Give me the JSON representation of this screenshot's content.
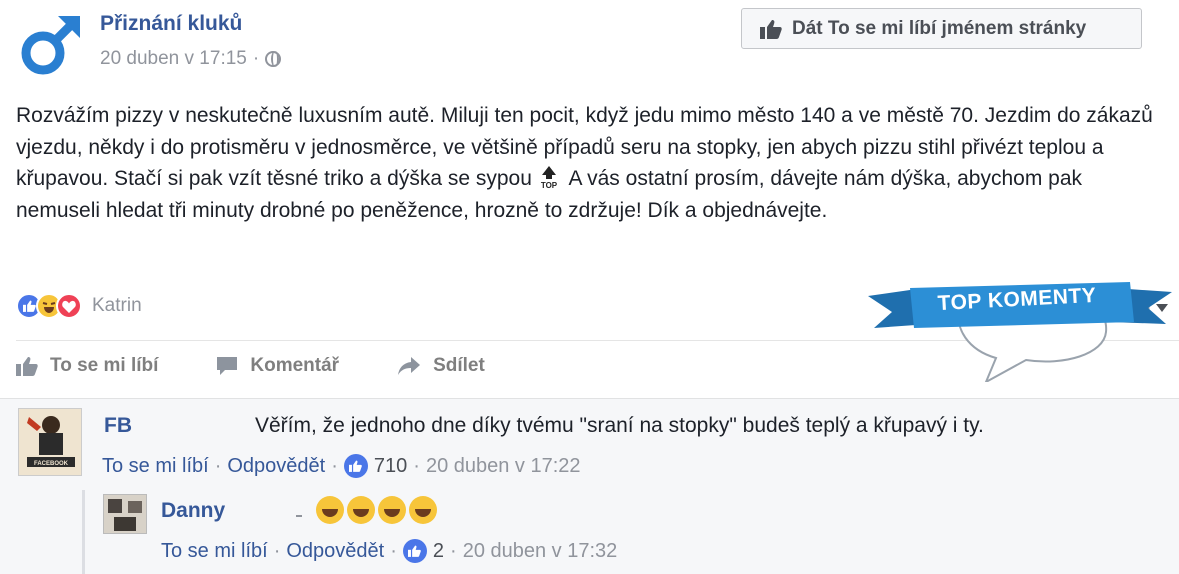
{
  "post": {
    "page_name": "Přiznání kluků",
    "timestamp": "20 duben v 17:15",
    "separator": "·",
    "like_page_button": "Dát To se mi líbí jménem stránky",
    "text_part1": "Rozvážím pizzy v neskutečně luxusním autě. Miluji ten pocit, když jedu mimo město 140 a ve městě 70. Jezdim do zákazů vjezdu, někdy i do protisměru v jednosměrce, ve většině případů seru na stopky, jen abych pizzu stihl přivézt teplou a křupavou. Stačí si pak vzít těsné triko a dýška se sypou",
    "top_emoji_label": "TOP",
    "text_part2": " A vás ostatní prosím, dávejte nám dýška, abychom pak nemuseli hledat tři minuty drobné po peněžence, hrozně to zdržuje! Dík a objednávejte.",
    "reactions_name": "Katrin",
    "actions": {
      "like": "To se mi líbí",
      "comment": "Komentář",
      "share": "Sdílet"
    },
    "badge": "TOP KOMENTY"
  },
  "comments": [
    {
      "author": "FB",
      "text": "Věřím, že jednoho dne díky tvému \"sraní na stopky\" budeš teplý a křupavý i ty.",
      "like_label": "To se mi líbí",
      "reply_label": "Odpovědět",
      "likes": "710",
      "time": "20 duben v 17:22",
      "avatar_text": "FACEBOOK"
    },
    {
      "author": "Danny",
      "like_label": "To se mi líbí",
      "reply_label": "Odpovědět",
      "likes": "2",
      "time": "20 duben v 17:32"
    }
  ],
  "colors": {
    "link": "#365899",
    "meta": "#90949c",
    "like_blue": "#4a76e8",
    "ribbon": "#2c8fd6"
  }
}
